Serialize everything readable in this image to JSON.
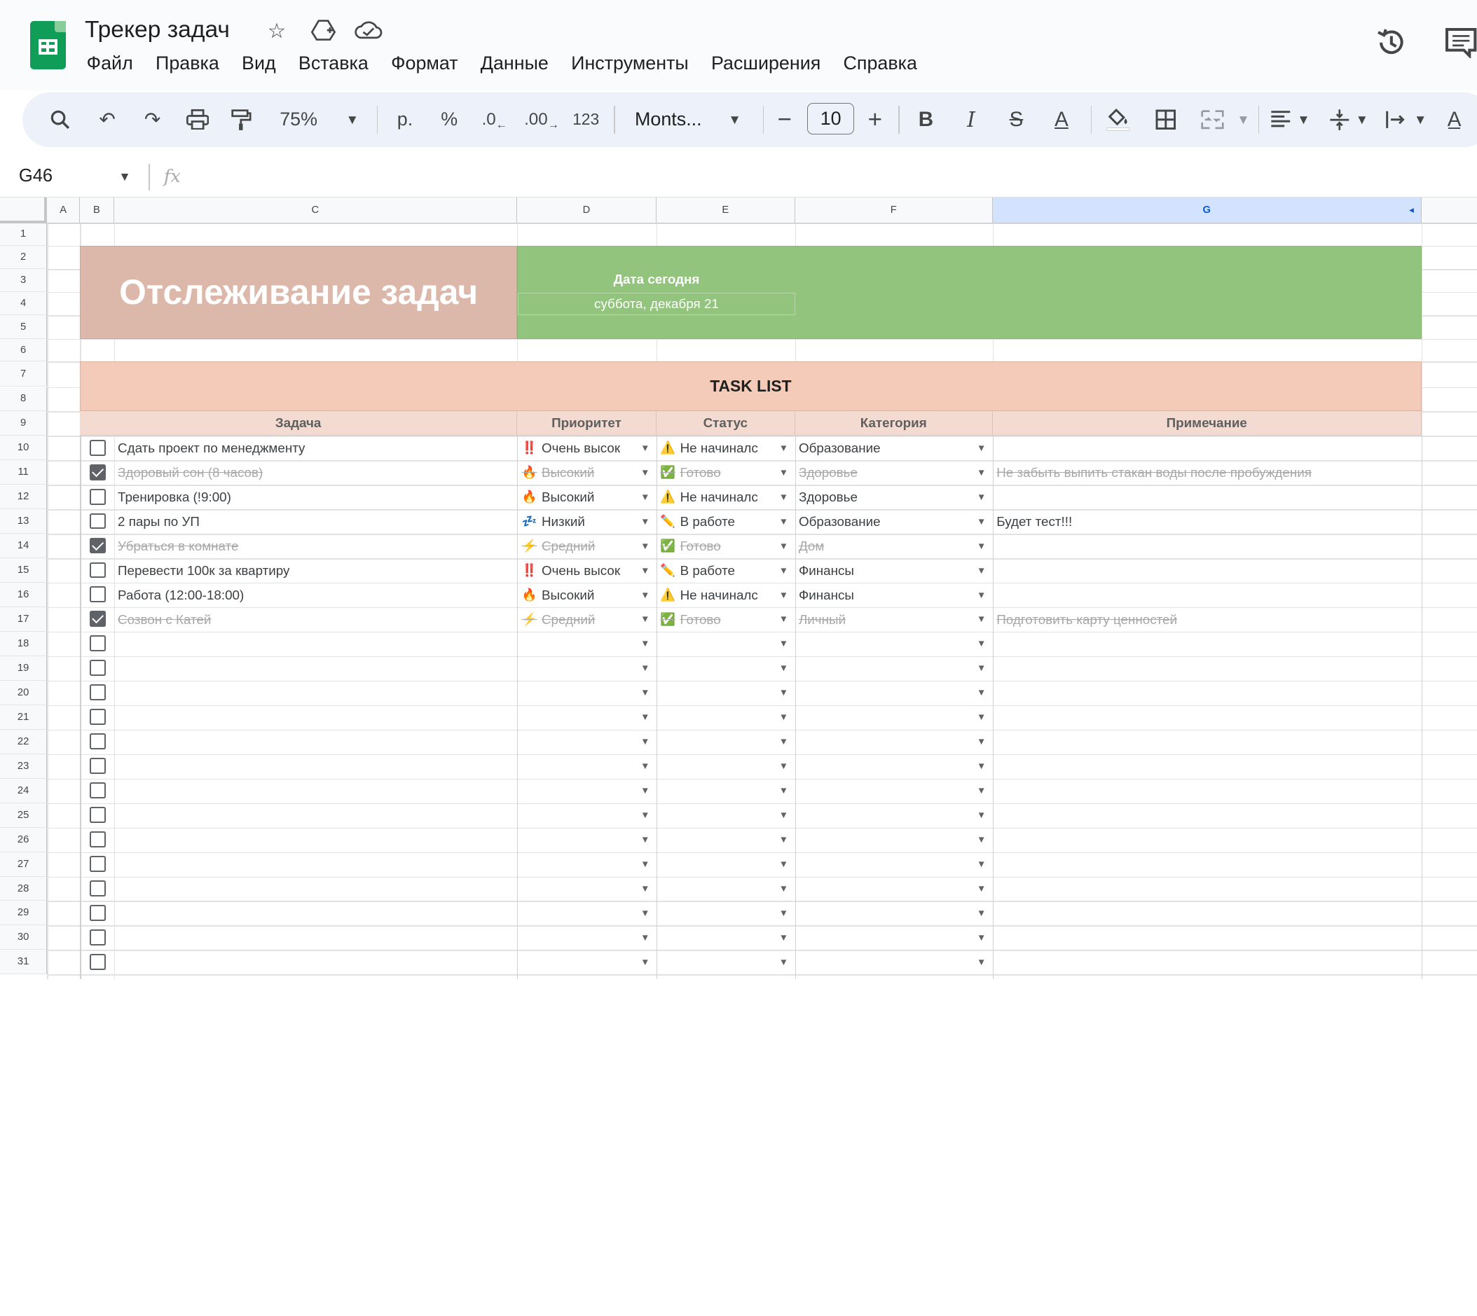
{
  "app": {
    "title": "Трекер задач",
    "menu": [
      "Файл",
      "Правка",
      "Вид",
      "Вставка",
      "Формат",
      "Данные",
      "Инструменты",
      "Расширения",
      "Справка"
    ]
  },
  "toolbar": {
    "zoom": "75%",
    "currency": "р.",
    "percent": "%",
    "decrease_decimal": ".0",
    "increase_decimal": ".00",
    "number_format": "123",
    "font": "Monts...",
    "font_size": "10",
    "bold": "B",
    "italic": "I",
    "strike": "S",
    "text_color": "A"
  },
  "formula_bar": {
    "cell_ref": "G46",
    "fx": "fx"
  },
  "columns": [
    "A",
    "B",
    "C",
    "D",
    "E",
    "F",
    "G"
  ],
  "rows": [
    "1",
    "2",
    "3",
    "4",
    "5",
    "6",
    "7",
    "8",
    "9",
    "10",
    "11",
    "12",
    "13",
    "14",
    "15",
    "16",
    "17",
    "18",
    "19",
    "20",
    "21",
    "22",
    "23",
    "24",
    "25",
    "26",
    "27",
    "28",
    "29",
    "30",
    "31"
  ],
  "sheet": {
    "title": "Отслеживание задач",
    "date_label": "Дата сегодня",
    "date_value": "суббота, декабря 21",
    "tasklist_title": "TASK LIST",
    "headers": [
      "Задача",
      "Приоритет",
      "Статус",
      "Категория",
      "Примечание"
    ],
    "tasks": [
      {
        "done": false,
        "task": "Сдать проект по менеджменту",
        "priority_icon": "‼️",
        "priority": "Очень высок",
        "status_icon": "⚠️",
        "status": "Не начиналс",
        "category": "Образование",
        "note": ""
      },
      {
        "done": true,
        "task": "Здоровый сон (8 часов)",
        "priority_icon": "🔥",
        "priority": "Высокий",
        "status_icon": "✅",
        "status": "Готово",
        "category": "Здоровье",
        "note": "Не забыть выпить стакан воды после пробуждения"
      },
      {
        "done": false,
        "task": "Тренировка (!9:00)",
        "priority_icon": "🔥",
        "priority": "Высокий",
        "status_icon": "⚠️",
        "status": "Не начиналс",
        "category": "Здоровье",
        "note": ""
      },
      {
        "done": false,
        "task": "2 пары по УП",
        "priority_icon": "💤",
        "priority": "Низкий",
        "status_icon": "✏️",
        "status": "В работе",
        "category": "Образование",
        "note": "Будет тест!!!"
      },
      {
        "done": true,
        "task": "Убраться в комнате",
        "priority_icon": "⚡",
        "priority": "Средний",
        "status_icon": "✅",
        "status": "Готово",
        "category": "Дом",
        "note": ""
      },
      {
        "done": false,
        "task": "Перевести 100к за квартиру",
        "priority_icon": "‼️",
        "priority": "Очень высок",
        "status_icon": "✏️",
        "status": "В работе",
        "category": "Финансы",
        "note": ""
      },
      {
        "done": false,
        "task": "Работа (12:00-18:00)",
        "priority_icon": "🔥",
        "priority": "Высокий",
        "status_icon": "⚠️",
        "status": "Не начиналс",
        "category": "Финансы",
        "note": ""
      },
      {
        "done": true,
        "task": "Созвон с Катей",
        "priority_icon": "⚡",
        "priority": "Средний",
        "status_icon": "✅",
        "status": "Готово",
        "category": "Личный",
        "note": "Подготовить карту ценностей"
      }
    ],
    "empty_rows": 14
  }
}
